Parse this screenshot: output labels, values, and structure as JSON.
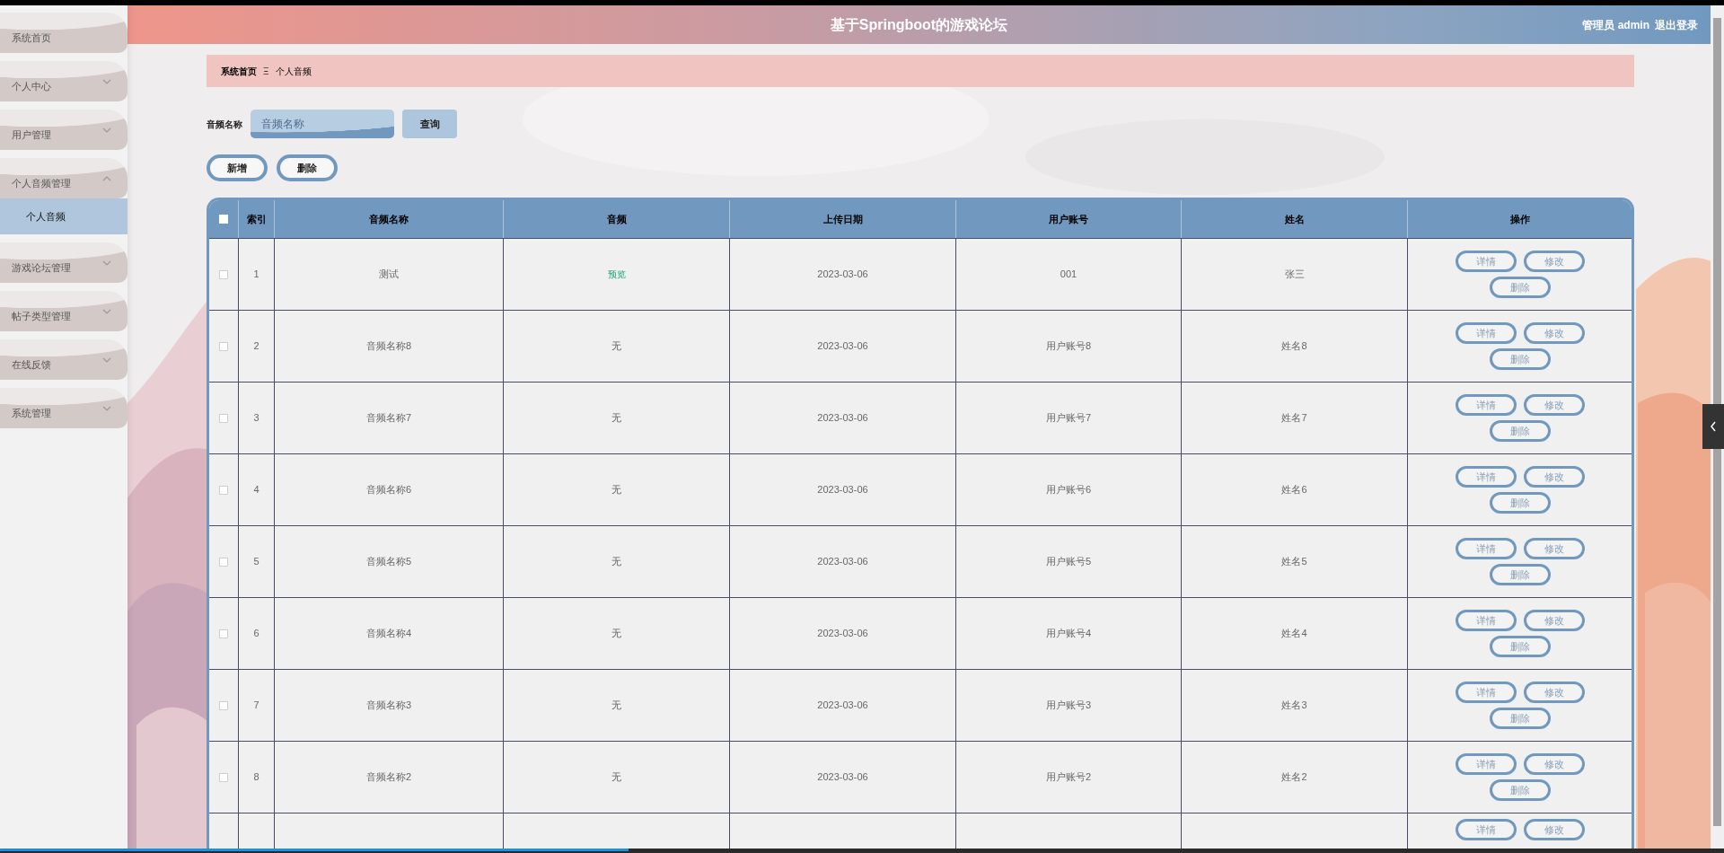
{
  "header": {
    "title": "基于Springboot的游戏论坛",
    "user": "管理员 admin",
    "logout": "退出登录"
  },
  "sidebar": {
    "items": [
      {
        "label": "系统首页"
      },
      {
        "label": "个人中心",
        "expanded": false
      },
      {
        "label": "用户管理",
        "expanded": false
      },
      {
        "label": "个人音频管理",
        "expanded": true,
        "children": [
          {
            "label": "个人音频",
            "selected": true
          }
        ]
      },
      {
        "label": "游戏论坛管理",
        "expanded": false
      },
      {
        "label": "帖子类型管理",
        "expanded": false
      },
      {
        "label": "在线反馈",
        "expanded": false
      },
      {
        "label": "系统管理",
        "expanded": false
      }
    ]
  },
  "breadcrumb": {
    "items": [
      "系统首页",
      "个人音频"
    ],
    "separator": "Ξ"
  },
  "search": {
    "label": "音频名称",
    "placeholder": "音频名称",
    "button": "查询"
  },
  "actions": [
    "新增",
    "删除"
  ],
  "table": {
    "select_all": {
      "checked": false
    },
    "columns": [
      "索引",
      "音频名称",
      "音频",
      "上传日期",
      "用户账号",
      "姓名",
      "操作"
    ],
    "rows": [
      {
        "checked": false,
        "index": "1",
        "name": "测试",
        "audio": {
          "kind": "link",
          "text": "预览"
        },
        "date": "2023-03-06",
        "account": "001",
        "person": "张三",
        "ops": [
          "详情",
          "修改",
          "删除"
        ]
      },
      {
        "checked": false,
        "index": "2",
        "name": "音频名称8",
        "audio": {
          "kind": "text",
          "text": "无"
        },
        "date": "2023-03-06",
        "account": "用户账号8",
        "person": "姓名8",
        "ops": [
          "详情",
          "修改",
          "删除"
        ]
      },
      {
        "checked": false,
        "index": "3",
        "name": "音频名称7",
        "audio": {
          "kind": "text",
          "text": "无"
        },
        "date": "2023-03-06",
        "account": "用户账号7",
        "person": "姓名7",
        "ops": [
          "详情",
          "修改",
          "删除"
        ]
      },
      {
        "checked": false,
        "index": "4",
        "name": "音频名称6",
        "audio": {
          "kind": "text",
          "text": "无"
        },
        "date": "2023-03-06",
        "account": "用户账号6",
        "person": "姓名6",
        "ops": [
          "详情",
          "修改",
          "删除"
        ]
      },
      {
        "checked": false,
        "index": "5",
        "name": "音频名称5",
        "audio": {
          "kind": "text",
          "text": "无"
        },
        "date": "2023-03-06",
        "account": "用户账号5",
        "person": "姓名5",
        "ops": [
          "详情",
          "修改",
          "删除"
        ]
      },
      {
        "checked": false,
        "index": "6",
        "name": "音频名称4",
        "audio": {
          "kind": "text",
          "text": "无"
        },
        "date": "2023-03-06",
        "account": "用户账号4",
        "person": "姓名4",
        "ops": [
          "详情",
          "修改",
          "删除"
        ]
      },
      {
        "checked": false,
        "index": "7",
        "name": "音频名称3",
        "audio": {
          "kind": "text",
          "text": "无"
        },
        "date": "2023-03-06",
        "account": "用户账号3",
        "person": "姓名3",
        "ops": [
          "详情",
          "修改",
          "删除"
        ]
      },
      {
        "checked": false,
        "index": "8",
        "name": "音频名称2",
        "audio": {
          "kind": "text",
          "text": "无"
        },
        "date": "2023-03-06",
        "account": "用户账号2",
        "person": "姓名2",
        "ops": [
          "详情",
          "修改",
          "删除"
        ]
      }
    ],
    "partial_row": {
      "ops": [
        "详情",
        "修改"
      ]
    }
  }
}
